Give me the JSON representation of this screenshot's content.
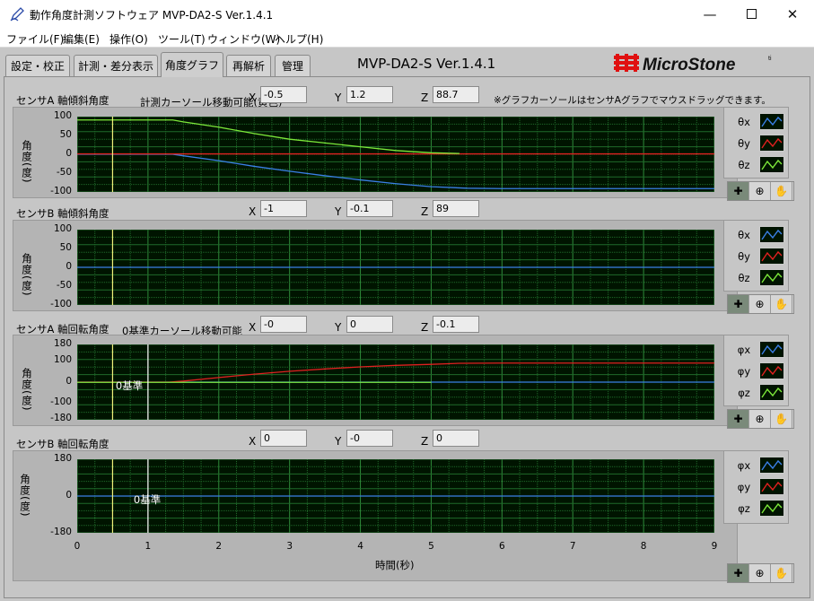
{
  "window": {
    "title": "動作角度計測ソフトウェア MVP-DA2-S Ver.1.4.1",
    "app_icon": "pen-icon",
    "controls": [
      "minimize-icon",
      "maximize-icon",
      "close-icon"
    ]
  },
  "menu": [
    "ファイル(F)",
    "編集(E)",
    "操作(O)",
    "ツール(T)",
    "ウィンドウ(W)",
    "ヘルプ(H)"
  ],
  "tabs": [
    {
      "label": "設定・校正",
      "active": false
    },
    {
      "label": "計測・差分表示",
      "active": false
    },
    {
      "label": "角度グラフ",
      "active": true
    },
    {
      "label": "再解析",
      "active": false
    },
    {
      "label": "管理",
      "active": false
    }
  ],
  "version": "MVP-DA2-S  Ver.1.4.1",
  "logo": {
    "text": "MicroStone",
    "mark": "M",
    "superscript": "ti",
    "color": "#e01010"
  },
  "note": "※グラフカーソールはセンサAグラフでマウスドラッグできます。",
  "colors": {
    "x": "#3a7fe6",
    "y": "#e02020",
    "z": "#7de83a",
    "grid": "#1f6a2a",
    "cursor": "#f0f07a",
    "base": "#ffffff"
  },
  "sections": [
    {
      "title": "センサA 軸傾斜角度",
      "subtitle": "計測カーソール移動可能(黄色)",
      "x": "-0.5",
      "y": "1.2",
      "z": "88.7",
      "ylabel": "角度(度)",
      "yticks": [
        "100",
        "50",
        "0",
        "-50",
        "-100"
      ],
      "legend": [
        "θx",
        "θy",
        "θz"
      ]
    },
    {
      "title": "センサB 軸傾斜角度",
      "subtitle": "",
      "x": "-1",
      "y": "-0.1",
      "z": "89",
      "ylabel": "角度(度)",
      "yticks": [
        "100",
        "50",
        "0",
        "-50",
        "-100"
      ],
      "legend": [
        "θx",
        "θy",
        "θz"
      ]
    },
    {
      "title": "センサA 軸回転角度",
      "subtitle": "0基準カーソール移動可能",
      "x": "-0",
      "y": "0",
      "z": "-0.1",
      "ylabel": "角度(度)",
      "yticks": [
        "180",
        "100",
        "0",
        "-100",
        "-180"
      ],
      "legend": [
        "φx",
        "φy",
        "φz"
      ],
      "base_label": "0基準"
    },
    {
      "title": "センサB 軸回転角度",
      "subtitle": "",
      "x": "0",
      "y": "-0",
      "z": "0",
      "ylabel": "角度(度)",
      "yticks": [
        "180",
        "0",
        "-180"
      ],
      "legend": [
        "φx",
        "φy",
        "φz"
      ],
      "base_label": "0基準"
    }
  ],
  "coord_labels": [
    "X",
    "Y",
    "Z"
  ],
  "x_axis": {
    "title": "時間(秒)",
    "ticks": [
      "0",
      "1",
      "2",
      "3",
      "4",
      "5",
      "6",
      "7",
      "8",
      "9"
    ]
  },
  "tool_icons": [
    "cursor-move-icon",
    "zoom-icon",
    "pan-hand-icon"
  ],
  "chart_data": [
    {
      "type": "line",
      "title": "センサA 軸傾斜角度",
      "xlabel": "",
      "ylabel": "角度(度)",
      "xlim": [
        0,
        9
      ],
      "ylim": [
        -100,
        100
      ],
      "cursor_x": 0.5,
      "series": [
        {
          "name": "θx",
          "x": [
            0,
            1.35,
            1.5,
            2,
            2.5,
            3,
            3.5,
            4,
            4.5,
            5,
            5.5,
            6,
            7,
            8,
            9
          ],
          "y": [
            0,
            0,
            -4,
            -17,
            -32,
            -45,
            -57,
            -68,
            -78,
            -86,
            -90,
            -91,
            -91,
            -91,
            -91
          ]
        },
        {
          "name": "θy",
          "x": [
            0,
            5.4,
            6,
            7,
            8,
            9
          ],
          "y": [
            1,
            1,
            1,
            1,
            1,
            1
          ]
        },
        {
          "name": "θz",
          "x": [
            0,
            1.35,
            1.5,
            2,
            2.5,
            3,
            3.5,
            4,
            4.5,
            5,
            5.4
          ],
          "y": [
            91,
            91,
            86,
            72,
            55,
            40,
            30,
            20,
            10,
            4,
            2
          ]
        }
      ]
    },
    {
      "type": "line",
      "title": "センサB 軸傾斜角度",
      "xlabel": "",
      "ylabel": "角度(度)",
      "xlim": [
        0,
        9
      ],
      "ylim": [
        -100,
        100
      ],
      "cursor_x": 0.5,
      "series": [
        {
          "name": "θx",
          "x": [
            0,
            9
          ],
          "y": [
            0,
            0
          ]
        }
      ]
    },
    {
      "type": "line",
      "title": "センサA 軸回転角度",
      "xlabel": "",
      "ylabel": "角度(度)",
      "xlim": [
        0,
        9
      ],
      "ylim": [
        -180,
        180
      ],
      "cursor_x": 0.5,
      "base_x": 1,
      "series": [
        {
          "name": "φx",
          "x": [
            0,
            9
          ],
          "y": [
            0,
            0
          ]
        },
        {
          "name": "φy",
          "x": [
            0,
            1.3,
            1.5,
            2,
            2.5,
            3,
            3.5,
            4,
            4.5,
            5,
            5.4,
            6,
            7,
            8,
            9
          ],
          "y": [
            0,
            0,
            5,
            22,
            38,
            52,
            63,
            73,
            80,
            85,
            90,
            91,
            91,
            91,
            91
          ]
        },
        {
          "name": "φz",
          "x": [
            0,
            5.0
          ],
          "y": [
            -1,
            -1
          ]
        }
      ]
    },
    {
      "type": "line",
      "title": "センサB 軸回転角度",
      "xlabel": "時間(秒)",
      "ylabel": "角度(度)",
      "xlim": [
        0,
        9
      ],
      "ylim": [
        -180,
        180
      ],
      "cursor_x": 0.5,
      "base_x": 1,
      "series": [
        {
          "name": "φx",
          "x": [
            0,
            9
          ],
          "y": [
            0,
            0
          ]
        }
      ]
    }
  ]
}
